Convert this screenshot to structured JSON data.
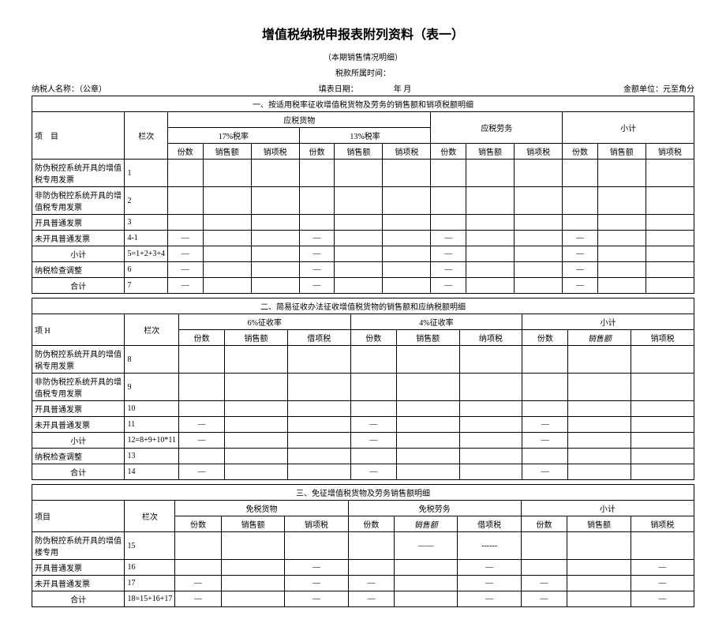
{
  "title": "增值税纳税申报表附列资料（表一）",
  "subtitle": "（本期销售情况明细）",
  "period_label": "税款所属时间：",
  "taxpayer_label": "纳税人名称：（公章）",
  "fill_date_label": "填表日期：",
  "fill_date_val": "年 月",
  "unit_label": "金额单位：元至角分",
  "sec1": "一、按适用税率征收增值税货物及劳务的销售额和销项税额明细",
  "col_item": "项　目",
  "col_lane": "栏次",
  "col_goods": "应税货物",
  "col_service": "应税劳务",
  "col_total": "小计",
  "rate17": "17%税率",
  "rate13": "13%税率",
  "c_copies": "份数",
  "c_sales": "销售额",
  "c_tax": "销项税",
  "r1": "防伪税控系统开具的增值税专用发票",
  "l1": "1",
  "r2": "非防伪税控系统开具的增值税专用发票",
  "l2": "2",
  "r3": "开具普通发票",
  "l3": "3",
  "r4": "未开具普通发票",
  "l4": "4-1",
  "r5": "小计",
  "l5": "5=1+2+3+4",
  "r6": "纳税检查调整",
  "l6": "6",
  "r7": "合计",
  "l7": "7",
  "sec2": "二、简易征收办法征收增值税货物的销售额和应纳税额明细",
  "col_item2": "项 H",
  "rate6": "6%征收率",
  "rate4": "4%征收率",
  "c_debit": "借项税",
  "c_natax": "纳项税",
  "c_sales_it": "销售额",
  "r8": "防伪税控系统开具的增值祸专用发票",
  "l8": "8",
  "r9": "非防伪税控系统开具的增值税专用发票",
  "l9": "9",
  "r10": "开具普通发票",
  "l10": "10",
  "r11": "未开具普通发票",
  "l11": "11",
  "r12": "小计",
  "l12": "12=8+9+10*11",
  "r13": "纳税检查调整",
  "l13": "13",
  "r14": "合计",
  "l14": "14",
  "sec3": "三、免征增值税货物及劳务销售额明细",
  "col_item3": "项目",
  "col_free_goods": "免税货物",
  "col_free_svc": "免税劳务",
  "c_sales_it2": "销售额",
  "r15": "防伪税控系统开具的增值楼专用",
  "l15": "15",
  "r16": "开具普通发票",
  "l16": "16",
  "r17": "未开具普通发票",
  "l17": "17",
  "r18": "合计",
  "l18": "18=15+16+17",
  "dash": "—",
  "em": "——",
  "lines": "------"
}
